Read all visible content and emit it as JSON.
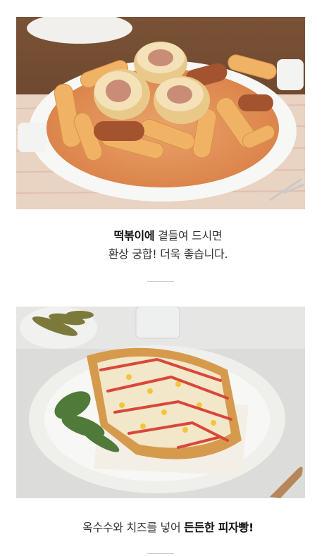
{
  "section1": {
    "caption_bold": "떡볶이에",
    "caption_line1_rest": " 곁들여 드시면",
    "caption_line2": "환상 궁합! 더욱 좋습니다."
  },
  "section2": {
    "caption_start": "옥수수와 치즈를 넣어 ",
    "caption_bold": "든든한 피자빵!"
  },
  "colors": {
    "divider": "#cfcfcf",
    "text": "#333333"
  }
}
